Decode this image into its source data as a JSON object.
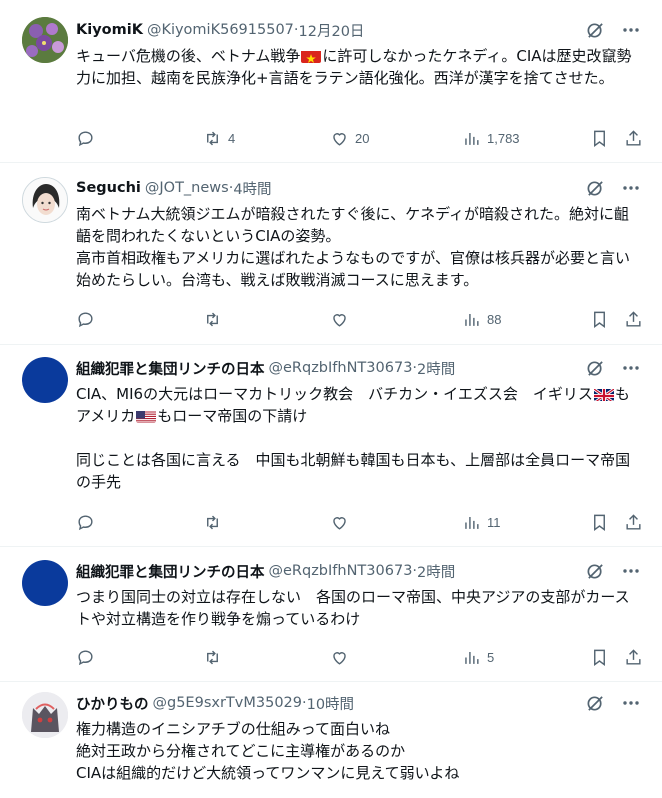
{
  "tweets": [
    {
      "name": "KiyomiK",
      "handle": "@KiyomiK56915507",
      "sep": " · ",
      "time": "12月20日",
      "text_a": "キューバ危機の後、ベトナム戦争",
      "text_b": "に許可しなかったケネディ。CIAは歴史改竄勢力に加担、越南を民族浄化+言語をラテン語化強化。西洋が漢字を捨てさせた。",
      "flag": "vietnam-flag",
      "replies": "",
      "retweets": "4",
      "likes": "20",
      "views": "1,783"
    },
    {
      "name": "Seguchi",
      "handle": "@JOT_news",
      "sep": " · ",
      "time": "4時間",
      "text": "南ベトナム大統領ジエムが暗殺されたすぐ後に、ケネディが暗殺された。絶対に齟齬を問われたくないというCIAの姿勢。\n高市首相政権もアメリカに選ばれたようなものですが、官僚は核兵器が必要と言い始めたらしい。台湾も、戦えば敗戦消滅コースに思えます。",
      "replies": "",
      "retweets": "",
      "likes": "",
      "views": "88"
    },
    {
      "name": "組織犯罪と集団リンチの日本",
      "handle": "@eRqzbIfhNT30673",
      "sep": " · ",
      "time": "2時間",
      "text_a": "CIA、MI6の大元はローマカトリック教会　バチカン・イエズス会　イギリス",
      "text_b": "もアメリカ",
      "text_c": "もローマ帝国の下請け\n\n同じことは各国に言える　中国も北朝鮮も韓国も日本も、上層部は全員ローマ帝国の手先",
      "flag_1": "uk-flag",
      "flag_2": "us-flag",
      "replies": "",
      "retweets": "",
      "likes": "",
      "views": "11"
    },
    {
      "name": "組織犯罪と集団リンチの日本",
      "handle": "@eRqzbIfhNT30673",
      "sep": " · ",
      "time": "2時間",
      "text": "つまり国同士の対立は存在しない　各国のローマ帝国、中央アジアの支部がカーストや対立構造を作り戦争を煽っているわけ",
      "replies": "",
      "retweets": "",
      "likes": "",
      "views": "5"
    },
    {
      "name": "ひかりもの",
      "handle": "@g5E9sxrTvM35029",
      "sep": " · ",
      "time": "10時間",
      "text": "権力構造のイニシアチブの仕組みって面白いね\n絶対王政から分権されてどこに主導権があるのか\nCIAは組織的だけど大統領ってワンマンに見えて弱いよね"
    }
  ],
  "colors": {
    "text": "#0f1419",
    "secondary": "#536471",
    "divider": "#eff3f4",
    "avatar_blue": "#0a3a9c"
  }
}
